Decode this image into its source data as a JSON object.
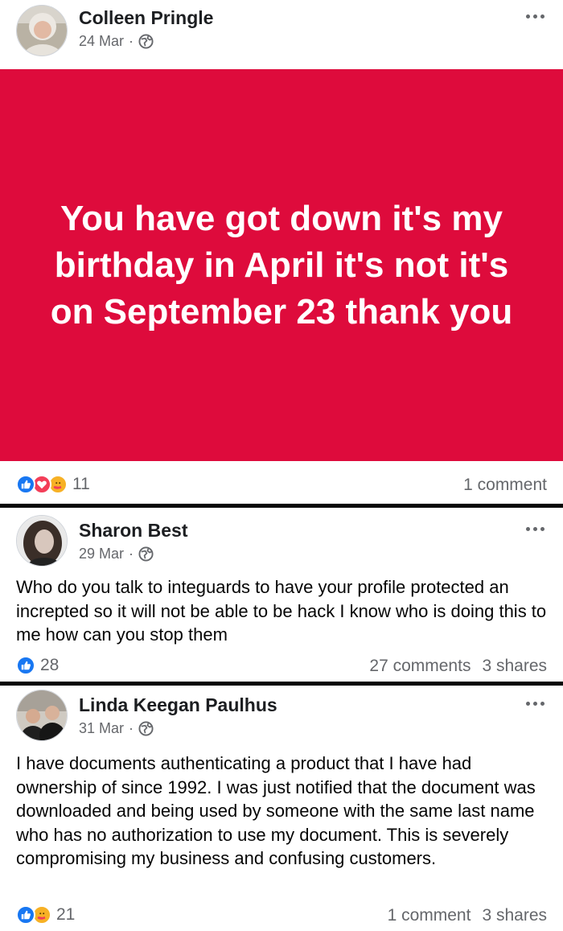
{
  "posts": [
    {
      "author": "Colleen Pringle",
      "date": "24 Mar",
      "separator": "·",
      "banner_text": "You have got down it's my birthday in April it's not it's on September 23 thank you",
      "banner_color": "#de0b3c",
      "reaction_icons": [
        "like-icon",
        "love-icon",
        "care-icon"
      ],
      "reaction_count": "11",
      "comments": "1 comment",
      "shares": ""
    },
    {
      "author": "Sharon Best",
      "date": "29 Mar",
      "separator": "·",
      "text": "Who do you talk to integuards to have your profile protected an increpted  so it will not be able to be hack I know who is doing this to me how can you stop them",
      "reaction_icons": [
        "like-icon"
      ],
      "reaction_count": "28",
      "comments": "27 comments",
      "shares": "3 shares"
    },
    {
      "author": "Linda Keegan Paulhus",
      "date": "31 Mar",
      "separator": "·",
      "text": "I have documents authenticating a product that I have had ownership of since 1992.  I was just notified that the document was downloaded and being used by someone with the same last name who has no authorization to use my document.  This is severely compromising my business and confusing customers.",
      "reaction_icons": [
        "like-icon",
        "care-icon"
      ],
      "reaction_count": "21",
      "comments": "1 comment",
      "shares": "3 shares"
    }
  ],
  "colors": {
    "like": "#1877f2",
    "love": "#f33e58",
    "care": "#f7b125",
    "meta_text": "#65676b"
  }
}
